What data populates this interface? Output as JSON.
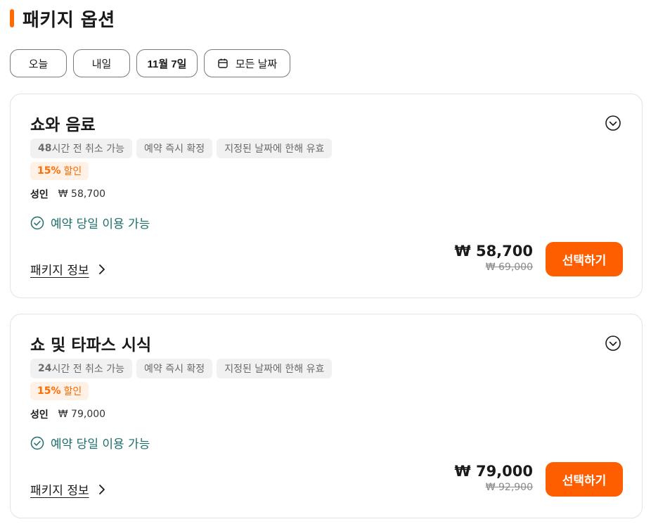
{
  "header": {
    "title": "패키지 옵션"
  },
  "dates": [
    {
      "label": "오늘"
    },
    {
      "label": "내일"
    },
    {
      "label": "11월 7일"
    },
    {
      "label": "모든 날짜",
      "icon": "calendar-icon"
    }
  ],
  "packages": [
    {
      "title": "쇼와 음료",
      "tags": {
        "cancel_hours": "48",
        "cancel_text": "시간 전 취소 가능",
        "instant": "예약 즉시 확정",
        "valid": "지정된 날짜에 한해 유효"
      },
      "discount": {
        "percent": "15%",
        "label": "할인"
      },
      "adult": {
        "label": "성인",
        "price": "₩ 58,700"
      },
      "availability": "예약 당일 이용 가능",
      "info_link": "패키지 정보",
      "price_now": "₩ 58,700",
      "price_old": "₩ 69,000",
      "select_label": "선택하기"
    },
    {
      "title": "쇼 및 타파스 시식",
      "tags": {
        "cancel_hours": "24",
        "cancel_text": "시간 전 취소 가능",
        "instant": "예약 즉시 확정",
        "valid": "지정된 날짜에 한해 유효"
      },
      "discount": {
        "percent": "15%",
        "label": "할인"
      },
      "adult": {
        "label": "성인",
        "price": "₩ 79,000"
      },
      "availability": "예약 당일 이용 가능",
      "info_link": "패키지 정보",
      "price_now": "₩ 79,000",
      "price_old": "₩ 92,900",
      "select_label": "선택하기"
    }
  ],
  "colors": {
    "accent": "#ff6b00",
    "button": "#ff5e00",
    "availability": "#1e6f6c",
    "discount_bg": "#fff1e6"
  }
}
